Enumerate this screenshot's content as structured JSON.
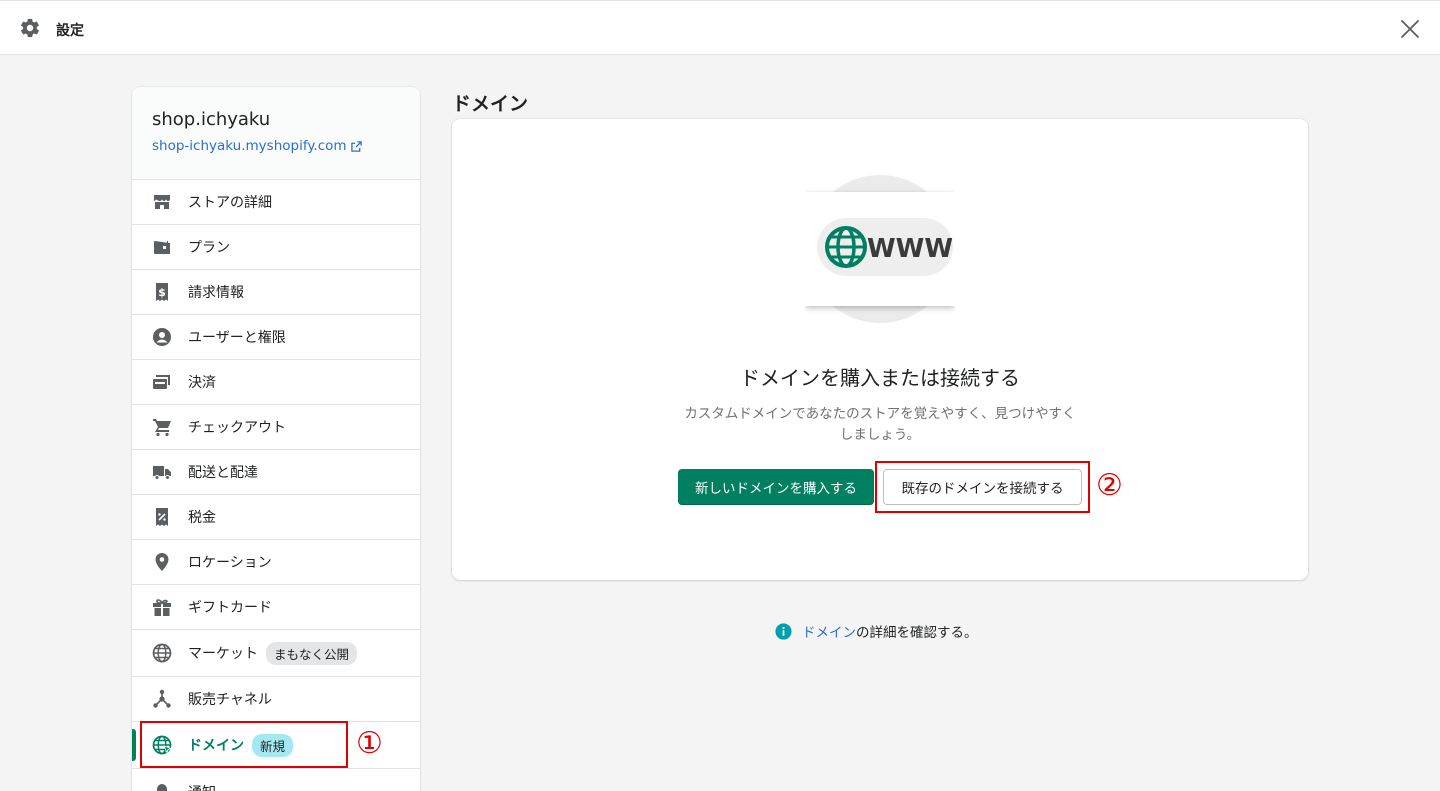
{
  "header": {
    "title": "設定",
    "icon": "gear-icon",
    "close_icon": "close-icon"
  },
  "store": {
    "name": "shop.ichyaku",
    "url": "shop-ichyaku.myshopify.com"
  },
  "nav": [
    {
      "label": "ストアの詳細",
      "icon": "store-icon"
    },
    {
      "label": "プラン",
      "icon": "wallet-icon"
    },
    {
      "label": "請求情報",
      "icon": "receipt-dollar-icon"
    },
    {
      "label": "ユーザーと権限",
      "icon": "user-circle-icon"
    },
    {
      "label": "決済",
      "icon": "credit-card-icon"
    },
    {
      "label": "チェックアウト",
      "icon": "cart-icon"
    },
    {
      "label": "配送と配達",
      "icon": "truck-icon"
    },
    {
      "label": "税金",
      "icon": "tax-receipt-icon"
    },
    {
      "label": "ロケーション",
      "icon": "location-pin-icon"
    },
    {
      "label": "ギフトカード",
      "icon": "gift-icon"
    },
    {
      "label": "マーケット",
      "icon": "globe-icon",
      "badge": "まもなく公開"
    },
    {
      "label": "販売チャネル",
      "icon": "channels-icon"
    },
    {
      "label": "ドメイン",
      "icon": "globe-cursor-icon",
      "badge": "新規",
      "active": true
    },
    {
      "label": "通知",
      "icon": "bell-icon"
    }
  ],
  "main": {
    "section_title": "ドメイン",
    "card": {
      "illustration_text": "WWW",
      "heading": "ドメインを購入または接続する",
      "description": "カスタムドメインであなたのストアを覚えやすく、見つけやすくしましょう。",
      "primary_button": "新しいドメインを購入する",
      "secondary_button": "既存のドメインを接続する"
    },
    "footer": {
      "link": "ドメイン",
      "text": "の詳細を確認する。"
    }
  },
  "annotations": {
    "marker_1": "①",
    "marker_2": "②"
  },
  "colors": {
    "brand_green": "#008060",
    "link_blue": "#2c6ecb",
    "annotation_red": "#e00000",
    "new_badge": "#a4e8f2"
  }
}
